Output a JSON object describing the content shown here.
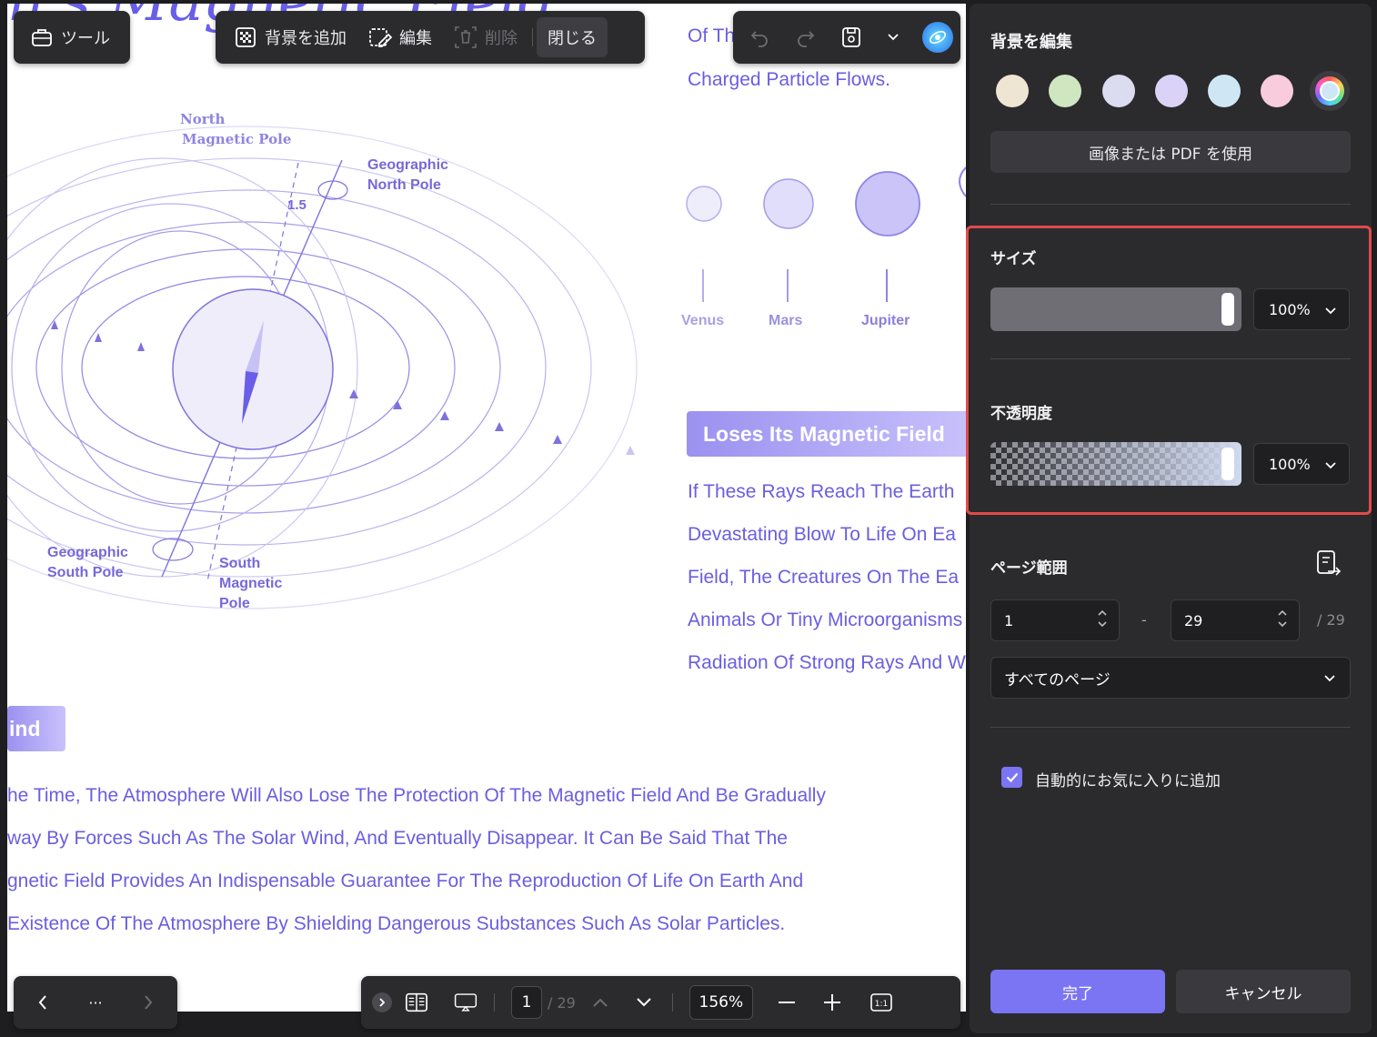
{
  "document": {
    "heading_fragment": "n's Magnetic Field",
    "diagram_labels": {
      "north_magnetic_pole": [
        "North",
        "Magnetic Pole"
      ],
      "geographic_north_pole": [
        "Geographic",
        "North Pole"
      ],
      "angle": "1.5",
      "geographic_south_pole": [
        "Geographic",
        "South Pole"
      ],
      "south_magnetic_pole": [
        "South",
        "Magnetic",
        "Pole"
      ]
    },
    "top_text": [
      "Of Th",
      "Charged Particle Flows."
    ],
    "planets": [
      "Venus",
      "Mars",
      "Jupiter"
    ],
    "highlight_title": "Loses Its Magnetic Field",
    "right_lines": [
      "If These Rays Reach The Earth",
      "Devastating Blow To Life On Ea",
      "Field, The Creatures On The Ea",
      "Animals Or Tiny Microorganisms",
      "Radiation Of Strong Rays And W"
    ],
    "left_highlight": "ind",
    "paragraph": [
      "he Time, The Atmosphere Will Also Lose The Protection Of The Magnetic Field And Be Gradually",
      "way By Forces Such As The Solar Wind, And Eventually Disappear. It Can Be Said That The",
      "gnetic Field Provides An Indispensable Guarantee For The Reproduction Of Life On Earth And",
      " Existence Of The Atmosphere By Shielding Dangerous Substances Such As Solar Particles."
    ]
  },
  "toolbar": {
    "tools_label": "ツール",
    "add_background": "背景を追加",
    "edit": "編集",
    "delete": "削除",
    "close": "閉じる"
  },
  "bottom_bar": {
    "current_page": "1",
    "total_pages": "/ 29",
    "zoom": "156%",
    "more": "···"
  },
  "panel": {
    "title": "背景を編集",
    "swatch_colors": [
      "#efe5d3",
      "#cfe6c1",
      "#dcdcf0",
      "#dbd3f7",
      "#cfe7f4",
      "#f8ccdc"
    ],
    "use_image_pdf": "画像または PDF を使用",
    "size_label": "サイズ",
    "size_value": "100%",
    "opacity_label": "不透明度",
    "opacity_value": "100%",
    "page_range_label": "ページ範囲",
    "range_from": "1",
    "range_separator": "-",
    "range_to": "29",
    "range_total": "/ 29",
    "page_filter": "すべてのページ",
    "auto_favorite": "自動的にお気に入りに追加",
    "auto_favorite_checked": true,
    "done": "完了",
    "cancel": "キャンセル",
    "accent": "#7b74f3",
    "highlight_border": "#e24a4a"
  }
}
